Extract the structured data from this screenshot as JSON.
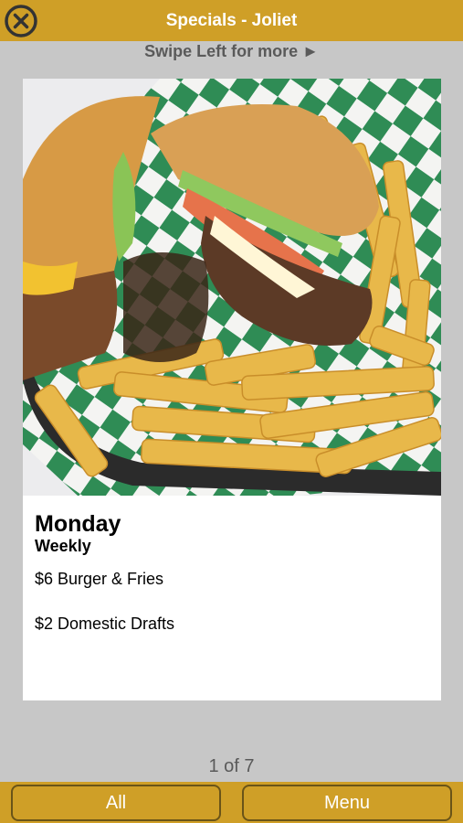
{
  "header": {
    "title": "Specials - Joliet",
    "close_icon": "close-x-circle-icon"
  },
  "swipe_hint": "Swipe Left for more ►",
  "special": {
    "day": "Monday",
    "frequency": "Weekly",
    "items": [
      "$6 Burger & Fries",
      "$2 Domestic Drafts"
    ],
    "image_subject": "burger and crinkle-cut fries in a basket"
  },
  "pager": {
    "current": 1,
    "total": 7,
    "label": "1 of 7"
  },
  "footer": {
    "all_label": "All",
    "menu_label": "Menu"
  },
  "colors": {
    "brand_gold": "#cf9f27",
    "background": "#c7c7c7",
    "card": "#ffffff"
  }
}
